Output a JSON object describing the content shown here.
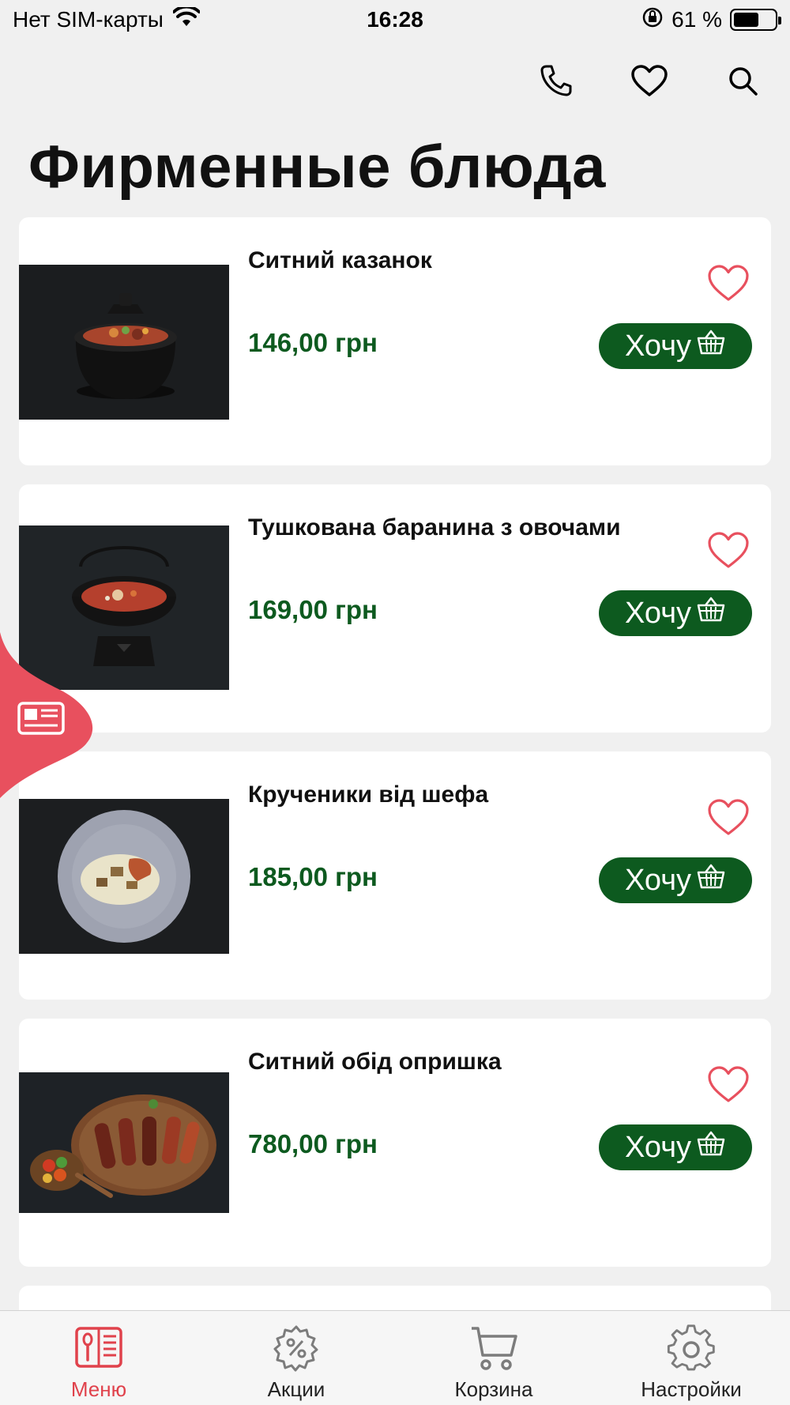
{
  "status_bar": {
    "carrier": "Нет SIM-карты",
    "time": "16:28",
    "battery_text": "61 %",
    "battery_level": 0.61
  },
  "header": {
    "title": "Фирменные блюда",
    "icons": [
      "phone-icon",
      "heart-icon",
      "search-icon"
    ]
  },
  "dishes": [
    {
      "name": "Ситний казанок",
      "price": "146,00 грн",
      "button": "Хочу"
    },
    {
      "name": "Тушкована баранина з овочами",
      "price": "169,00 грн",
      "button": "Хочу"
    },
    {
      "name": "Кручени­ки від шефа",
      "price": "185,00 грн",
      "button": "Хочу"
    },
    {
      "name": "Ситний обід опришка",
      "price": "780,00 грн",
      "button": "Хочу"
    }
  ],
  "tabs": [
    {
      "label": "Меню",
      "icon": "menu-book-icon",
      "active": true
    },
    {
      "label": "Акции",
      "icon": "discount-gear-icon",
      "active": false
    },
    {
      "label": "Корзина",
      "icon": "cart-icon",
      "active": false
    },
    {
      "label": "Настройки",
      "icon": "settings-gear-icon",
      "active": false
    }
  ],
  "colors": {
    "accent_green": "#0d5a1f",
    "accent_red": "#e0424c",
    "heart_pink": "#e8505e",
    "background": "#f0f0f0"
  }
}
